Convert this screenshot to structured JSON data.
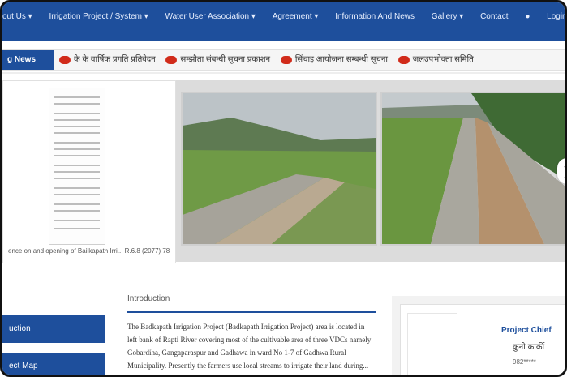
{
  "nav": {
    "items": [
      {
        "label": "out Us ▾"
      },
      {
        "label": "Irrigation Project / System ▾"
      },
      {
        "label": "Water User Association ▾"
      },
      {
        "label": "Agreement ▾"
      },
      {
        "label": "Information And News"
      },
      {
        "label": "Gallery ▾"
      },
      {
        "label": "Contact"
      },
      {
        "label": "Login"
      }
    ]
  },
  "ticker": {
    "label": "g News",
    "items": [
      {
        "text": "के के वार्षिक प्रगति प्रतिवेदन"
      },
      {
        "text": "सम्झौता संबन्धी सूचना प्रकाशन"
      },
      {
        "text": "सिंचाइ आयोजना सम्बन्धी सूचना"
      },
      {
        "text": "जलउपभोक्ता समिति"
      }
    ]
  },
  "doc_card": {
    "caption": "ence on and opening of Bailkapath Irri... R.6.8 (2077) 78"
  },
  "photos": [
    {
      "name": "canal-photo-1"
    },
    {
      "name": "canal-photo-2"
    }
  ],
  "sidebar": {
    "items": [
      {
        "label": "uction"
      },
      {
        "label": "ect Map"
      }
    ]
  },
  "intro": {
    "title": "Introduction",
    "text": "The Badkapath Irrigation Project (Badkapath Irrigation Project) area is located in left bank of Rapti River covering most of the cultivable area of three VDCs namely Gobardiha, Gangaparaspur and Gadhawa in ward No 1-7 of Gadhwa Rural Municipality. Presently the farmers use local streams to irrigate their land during..."
  },
  "project_chief": {
    "title": "Project Chief",
    "name": "कुनी कार्की",
    "phone": "982*****"
  },
  "colors": {
    "brand_blue": "#1e4f9c",
    "badge_red": "#d12b1a"
  }
}
